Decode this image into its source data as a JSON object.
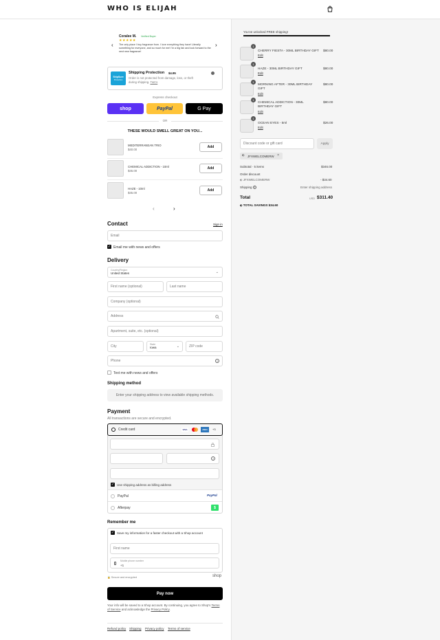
{
  "header": {
    "logo": "WHO IS ELIJAH",
    "cart_icon": "bag-icon"
  },
  "review": {
    "name": "Coralee M.",
    "verified": "Verified Buyer",
    "stars": "★★★★★",
    "text": "The only place I buy fragrance from. I love everything they have! Literally something for everyone, and so much for me! I'm a big fan and look forward to the next new fragrance!"
  },
  "protection": {
    "logo_text": "ShipSure",
    "logo_sub": "Protection",
    "title": "Shipping Protection",
    "price": "$4.95",
    "desc": "Order is not protected from damage, loss, or theft during shipping.",
    "link": "T&Cs"
  },
  "express": {
    "label": "Express checkout",
    "shop": "shop",
    "paypal": "PayPal",
    "gpay": "G Pay",
    "or": "OR"
  },
  "upsell": {
    "title": "THESE WOULD SMELL GREAT ON YOU...",
    "add_label": "Add",
    "items": [
      {
        "name": "MEDITERRANEAN TRIO",
        "price": "$40.00"
      },
      {
        "name": "CHEMICAL ADDICTION - 10ml",
        "price": "$45.00"
      },
      {
        "name": "HAZE - 10ml",
        "price": "$45.00"
      }
    ]
  },
  "contact": {
    "title": "Contact",
    "signin": "Sign in",
    "email_placeholder": "Email",
    "news_label": "Email me with news and offers"
  },
  "delivery": {
    "title": "Delivery",
    "country_label": "Country/Region",
    "country_value": "United States",
    "first_name": "First name (optional)",
    "last_name": "Last name",
    "company": "Company (optional)",
    "address": "Address",
    "apartment": "Apartment, suite, etc. (optional)",
    "city": "City",
    "state_label": "State",
    "state_value": "Iowa",
    "zip": "ZIP code",
    "phone": "Phone",
    "text_label": "Text me with news and offers"
  },
  "shipping_method": {
    "title": "Shipping method",
    "placeholder": "Enter your shipping address to view available shipping methods."
  },
  "payment": {
    "title": "Payment",
    "subtitle": "All transactions are secure and encrypted.",
    "credit_card": "Credit card",
    "cards": [
      "VISA",
      "MC",
      "AMEX",
      "+3"
    ],
    "billing_label": "Use shipping address as billing address",
    "paypal": "PayPal",
    "paypal_logo": "PayPal",
    "afterpay": "Afterpay",
    "afterpay_logo": "$"
  },
  "remember": {
    "title": "Remember me",
    "save_label": "Save my information for a faster checkout with a Shop account",
    "first_name": "First name",
    "phone_label": "Mobile phone number",
    "phone_value": "+1",
    "secure": "Secure and encrypted",
    "shop_logo": "shop"
  },
  "paynow": {
    "button": "Pay now",
    "legal_1": "Your info will be saved to a Shop account. By continuing, you agree to Shop's",
    "terms": "Terms of Service",
    "legal_2": "and acknowledge the",
    "privacy": "Privacy Policy",
    "legal_3": "."
  },
  "footer": {
    "links": [
      "Refund policy",
      "Shipping",
      "Privacy policy",
      "Terms of service"
    ]
  },
  "summary": {
    "free_shipping": "You've unlocked FREE shipping!",
    "progress": 1.0,
    "edit": "Edit",
    "items": [
      {
        "qty": "1",
        "name": "CHERRY FIESTA - 30ML BIRTHDAY GIFT",
        "price": "$80.00"
      },
      {
        "qty": "1",
        "name": "HAZE - 30ML BIRTHDAY GIFT",
        "price": "$80.00"
      },
      {
        "qty": "1",
        "name": "MORNING AFTER - 30ML BIRTHDAY GIFT",
        "price": "$80.00"
      },
      {
        "qty": "1",
        "name": "CHEMICAL ADDICTION - 30ML BIRTHDAY GIFT",
        "price": "$80.00"
      },
      {
        "qty": "1",
        "name": "OCEAN EYES - 5ml",
        "price": "$26.00"
      }
    ],
    "discount_placeholder": "Discount code or gift card",
    "apply": "Apply",
    "code": "JFXWELCOMERW",
    "subtotal_label": "Subtotal · 5 items",
    "subtotal_value": "$346.00",
    "order_discount": "Order discount",
    "discount_code": "JFXWELCOMERW",
    "discount_value": "- $34.60",
    "shipping_label": "Shipping",
    "shipping_value": "Enter shipping address",
    "total_label": "Total",
    "currency": "USD",
    "total_value": "$311.40",
    "savings_label": "TOTAL SAVINGS",
    "savings_value": "$34.60"
  },
  "colors": {
    "shop": "#5a31f4",
    "paypal": "#ffc439",
    "gpay": "#000000",
    "afterpay": "#2ee06a"
  }
}
